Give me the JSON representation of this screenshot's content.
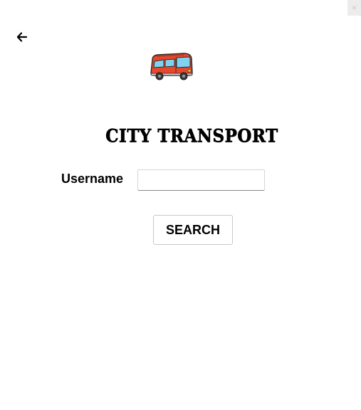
{
  "header": {
    "back_icon": "arrow-left-icon",
    "close_icon": "close-icon",
    "logo_icon": "bus-icon"
  },
  "main": {
    "title": "CITY TRANSPORT",
    "username_label": "Username",
    "username_value": "",
    "search_label": "SEARCH"
  },
  "colors": {
    "bus_body": "#e8472b",
    "bus_window": "#7fd3f0",
    "bus_wheel": "#3a3a3a"
  }
}
